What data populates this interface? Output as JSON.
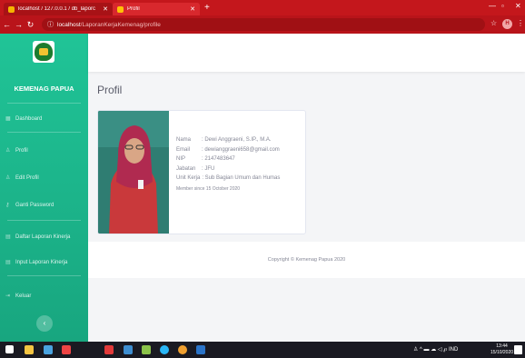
{
  "browser": {
    "tab1_title": "localhost / 127.0.0.1 / db_laporc",
    "tab2_title": "Profil",
    "url_host": "localhost",
    "url_path": "/LaporanKerjaKemenag/profile",
    "ext_badge": "H",
    "accent": "#c4171c"
  },
  "sidebar": {
    "brand": "KEMENAG PAPUA",
    "items": [
      {
        "label": "Dashboard",
        "icon": "dashboard-icon"
      },
      {
        "label": "Profil",
        "icon": "user-icon"
      },
      {
        "label": "Edit Profil",
        "icon": "user-edit-icon"
      },
      {
        "label": "Ganti Password",
        "icon": "key-icon"
      },
      {
        "label": "Daftar Laporan Kinerja",
        "icon": "list-icon"
      },
      {
        "label": "Input Laporan Kinerja",
        "icon": "input-icon"
      },
      {
        "label": "Keluar",
        "icon": "logout-icon"
      }
    ],
    "color": "#1cb98c"
  },
  "main": {
    "title": "Profil",
    "profile": {
      "nama_label": "Nama",
      "nama": ": Dewi Anggraeni, S.IP., M.A.",
      "email_label": "Email",
      "email": ": dewianggraeni658@gmail.com",
      "nip_label": "NIP",
      "nip": ": 2147483647",
      "jabatan_label": "Jabatan",
      "jabatan": ": JFU",
      "unit_label": "Unit Kerja",
      "unit": ": Sub Bagian Umum dan Humas",
      "since": "Member since 15 October 2020"
    },
    "footer": "Copyright © Kemenag Papua 2020"
  },
  "taskbar": {
    "tray_lang": "IND",
    "time": "13:44",
    "date": "15/10/2020"
  }
}
